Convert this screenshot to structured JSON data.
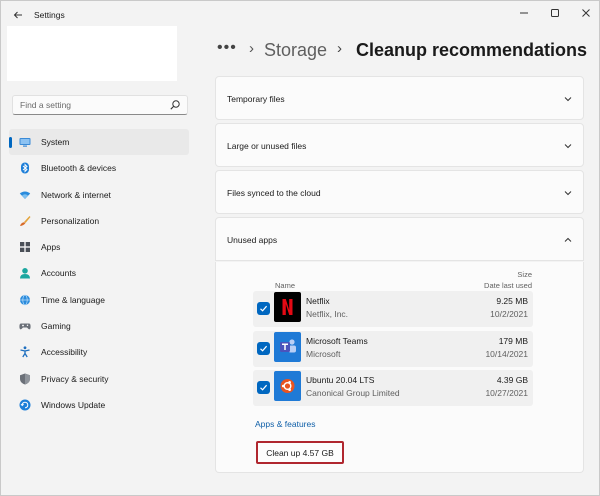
{
  "window": {
    "title": "Settings",
    "controls": [
      "minimize",
      "maximize",
      "close"
    ]
  },
  "search": {
    "placeholder": "Find a setting"
  },
  "sidebar": {
    "items": [
      {
        "label": "System",
        "icon": "monitor-icon",
        "active": true
      },
      {
        "label": "Bluetooth & devices",
        "icon": "bluetooth-icon"
      },
      {
        "label": "Network & internet",
        "icon": "wifi-icon"
      },
      {
        "label": "Personalization",
        "icon": "brush-icon"
      },
      {
        "label": "Apps",
        "icon": "apps-icon"
      },
      {
        "label": "Accounts",
        "icon": "person-icon"
      },
      {
        "label": "Time & language",
        "icon": "globe-icon"
      },
      {
        "label": "Gaming",
        "icon": "gamepad-icon"
      },
      {
        "label": "Accessibility",
        "icon": "accessibility-icon"
      },
      {
        "label": "Privacy & security",
        "icon": "shield-icon"
      },
      {
        "label": "Windows Update",
        "icon": "update-icon"
      }
    ]
  },
  "header": {
    "more": "•••",
    "parent": "Storage",
    "current": "Cleanup recommendations"
  },
  "sections": [
    {
      "title": "Temporary files",
      "expanded": false
    },
    {
      "title": "Large or unused files",
      "expanded": false
    },
    {
      "title": "Files synced to the cloud",
      "expanded": false
    },
    {
      "title": "Unused apps",
      "expanded": true
    }
  ],
  "unused_apps": {
    "columns": {
      "name": "Name",
      "size": "Size",
      "date": "Date last used"
    },
    "rows": [
      {
        "name": "Netflix",
        "publisher": "Netflix, Inc.",
        "size": "9.25 MB",
        "date": "10/2/2021",
        "checked": true,
        "logo_bg": "#000000",
        "logo_fg": "#e50914"
      },
      {
        "name": "Microsoft Teams",
        "publisher": "Microsoft",
        "size": "179 MB",
        "date": "10/14/2021",
        "checked": true,
        "logo_bg": "#1f7ad6",
        "logo_fg": "#ffffff"
      },
      {
        "name": "Ubuntu 20.04 LTS",
        "publisher": "Canonical Group Limited",
        "size": "4.39 GB",
        "date": "10/27/2021",
        "checked": true,
        "logo_bg": "#1f7ad6",
        "logo_fg": "#e95420"
      }
    ],
    "link": "Apps & features",
    "button": "Clean up 4.57 GB"
  },
  "colors": {
    "accent": "#0067c0",
    "highlight_border": "#b0272f"
  }
}
